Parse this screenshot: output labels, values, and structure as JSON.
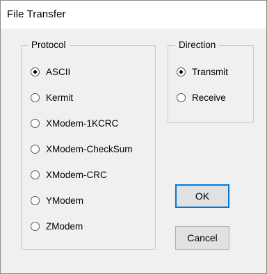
{
  "window": {
    "title": "File Transfer"
  },
  "protocol": {
    "legend": "Protocol",
    "options": [
      {
        "label": "ASCII",
        "checked": true
      },
      {
        "label": "Kermit",
        "checked": false
      },
      {
        "label": "XModem-1KCRC",
        "checked": false
      },
      {
        "label": "XModem-CheckSum",
        "checked": false
      },
      {
        "label": "XModem-CRC",
        "checked": false
      },
      {
        "label": "YModem",
        "checked": false
      },
      {
        "label": "ZModem",
        "checked": false
      }
    ]
  },
  "direction": {
    "legend": "Direction",
    "options": [
      {
        "label": "Transmit",
        "checked": true
      },
      {
        "label": "Receive",
        "checked": false
      }
    ]
  },
  "buttons": {
    "ok_label": "OK",
    "cancel_label": "Cancel"
  },
  "colors": {
    "dialog_background": "#f0f0f0",
    "title_background": "#ffffff",
    "default_button_accent": "#0078d7"
  }
}
